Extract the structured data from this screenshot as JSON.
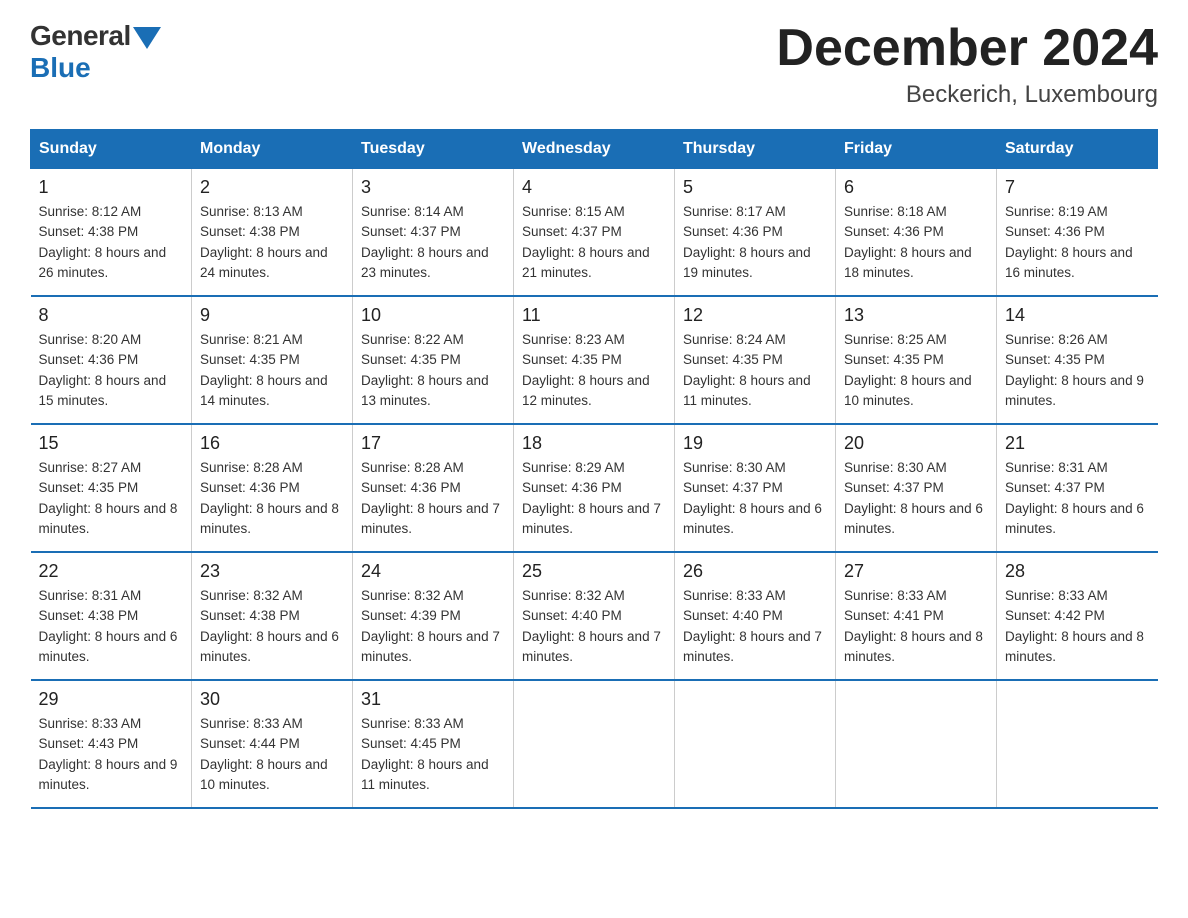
{
  "logo": {
    "general": "General",
    "blue": "Blue"
  },
  "title": {
    "month": "December 2024",
    "location": "Beckerich, Luxembourg"
  },
  "headers": [
    "Sunday",
    "Monday",
    "Tuesday",
    "Wednesday",
    "Thursday",
    "Friday",
    "Saturday"
  ],
  "weeks": [
    [
      {
        "day": "1",
        "sunrise": "8:12 AM",
        "sunset": "4:38 PM",
        "daylight": "8 hours and 26 minutes."
      },
      {
        "day": "2",
        "sunrise": "8:13 AM",
        "sunset": "4:38 PM",
        "daylight": "8 hours and 24 minutes."
      },
      {
        "day": "3",
        "sunrise": "8:14 AM",
        "sunset": "4:37 PM",
        "daylight": "8 hours and 23 minutes."
      },
      {
        "day": "4",
        "sunrise": "8:15 AM",
        "sunset": "4:37 PM",
        "daylight": "8 hours and 21 minutes."
      },
      {
        "day": "5",
        "sunrise": "8:17 AM",
        "sunset": "4:36 PM",
        "daylight": "8 hours and 19 minutes."
      },
      {
        "day": "6",
        "sunrise": "8:18 AM",
        "sunset": "4:36 PM",
        "daylight": "8 hours and 18 minutes."
      },
      {
        "day": "7",
        "sunrise": "8:19 AM",
        "sunset": "4:36 PM",
        "daylight": "8 hours and 16 minutes."
      }
    ],
    [
      {
        "day": "8",
        "sunrise": "8:20 AM",
        "sunset": "4:36 PM",
        "daylight": "8 hours and 15 minutes."
      },
      {
        "day": "9",
        "sunrise": "8:21 AM",
        "sunset": "4:35 PM",
        "daylight": "8 hours and 14 minutes."
      },
      {
        "day": "10",
        "sunrise": "8:22 AM",
        "sunset": "4:35 PM",
        "daylight": "8 hours and 13 minutes."
      },
      {
        "day": "11",
        "sunrise": "8:23 AM",
        "sunset": "4:35 PM",
        "daylight": "8 hours and 12 minutes."
      },
      {
        "day": "12",
        "sunrise": "8:24 AM",
        "sunset": "4:35 PM",
        "daylight": "8 hours and 11 minutes."
      },
      {
        "day": "13",
        "sunrise": "8:25 AM",
        "sunset": "4:35 PM",
        "daylight": "8 hours and 10 minutes."
      },
      {
        "day": "14",
        "sunrise": "8:26 AM",
        "sunset": "4:35 PM",
        "daylight": "8 hours and 9 minutes."
      }
    ],
    [
      {
        "day": "15",
        "sunrise": "8:27 AM",
        "sunset": "4:35 PM",
        "daylight": "8 hours and 8 minutes."
      },
      {
        "day": "16",
        "sunrise": "8:28 AM",
        "sunset": "4:36 PM",
        "daylight": "8 hours and 8 minutes."
      },
      {
        "day": "17",
        "sunrise": "8:28 AM",
        "sunset": "4:36 PM",
        "daylight": "8 hours and 7 minutes."
      },
      {
        "day": "18",
        "sunrise": "8:29 AM",
        "sunset": "4:36 PM",
        "daylight": "8 hours and 7 minutes."
      },
      {
        "day": "19",
        "sunrise": "8:30 AM",
        "sunset": "4:37 PM",
        "daylight": "8 hours and 6 minutes."
      },
      {
        "day": "20",
        "sunrise": "8:30 AM",
        "sunset": "4:37 PM",
        "daylight": "8 hours and 6 minutes."
      },
      {
        "day": "21",
        "sunrise": "8:31 AM",
        "sunset": "4:37 PM",
        "daylight": "8 hours and 6 minutes."
      }
    ],
    [
      {
        "day": "22",
        "sunrise": "8:31 AM",
        "sunset": "4:38 PM",
        "daylight": "8 hours and 6 minutes."
      },
      {
        "day": "23",
        "sunrise": "8:32 AM",
        "sunset": "4:38 PM",
        "daylight": "8 hours and 6 minutes."
      },
      {
        "day": "24",
        "sunrise": "8:32 AM",
        "sunset": "4:39 PM",
        "daylight": "8 hours and 7 minutes."
      },
      {
        "day": "25",
        "sunrise": "8:32 AM",
        "sunset": "4:40 PM",
        "daylight": "8 hours and 7 minutes."
      },
      {
        "day": "26",
        "sunrise": "8:33 AM",
        "sunset": "4:40 PM",
        "daylight": "8 hours and 7 minutes."
      },
      {
        "day": "27",
        "sunrise": "8:33 AM",
        "sunset": "4:41 PM",
        "daylight": "8 hours and 8 minutes."
      },
      {
        "day": "28",
        "sunrise": "8:33 AM",
        "sunset": "4:42 PM",
        "daylight": "8 hours and 8 minutes."
      }
    ],
    [
      {
        "day": "29",
        "sunrise": "8:33 AM",
        "sunset": "4:43 PM",
        "daylight": "8 hours and 9 minutes."
      },
      {
        "day": "30",
        "sunrise": "8:33 AM",
        "sunset": "4:44 PM",
        "daylight": "8 hours and 10 minutes."
      },
      {
        "day": "31",
        "sunrise": "8:33 AM",
        "sunset": "4:45 PM",
        "daylight": "8 hours and 11 minutes."
      },
      null,
      null,
      null,
      null
    ]
  ],
  "labels": {
    "sunrise": "Sunrise:",
    "sunset": "Sunset:",
    "daylight": "Daylight:"
  }
}
